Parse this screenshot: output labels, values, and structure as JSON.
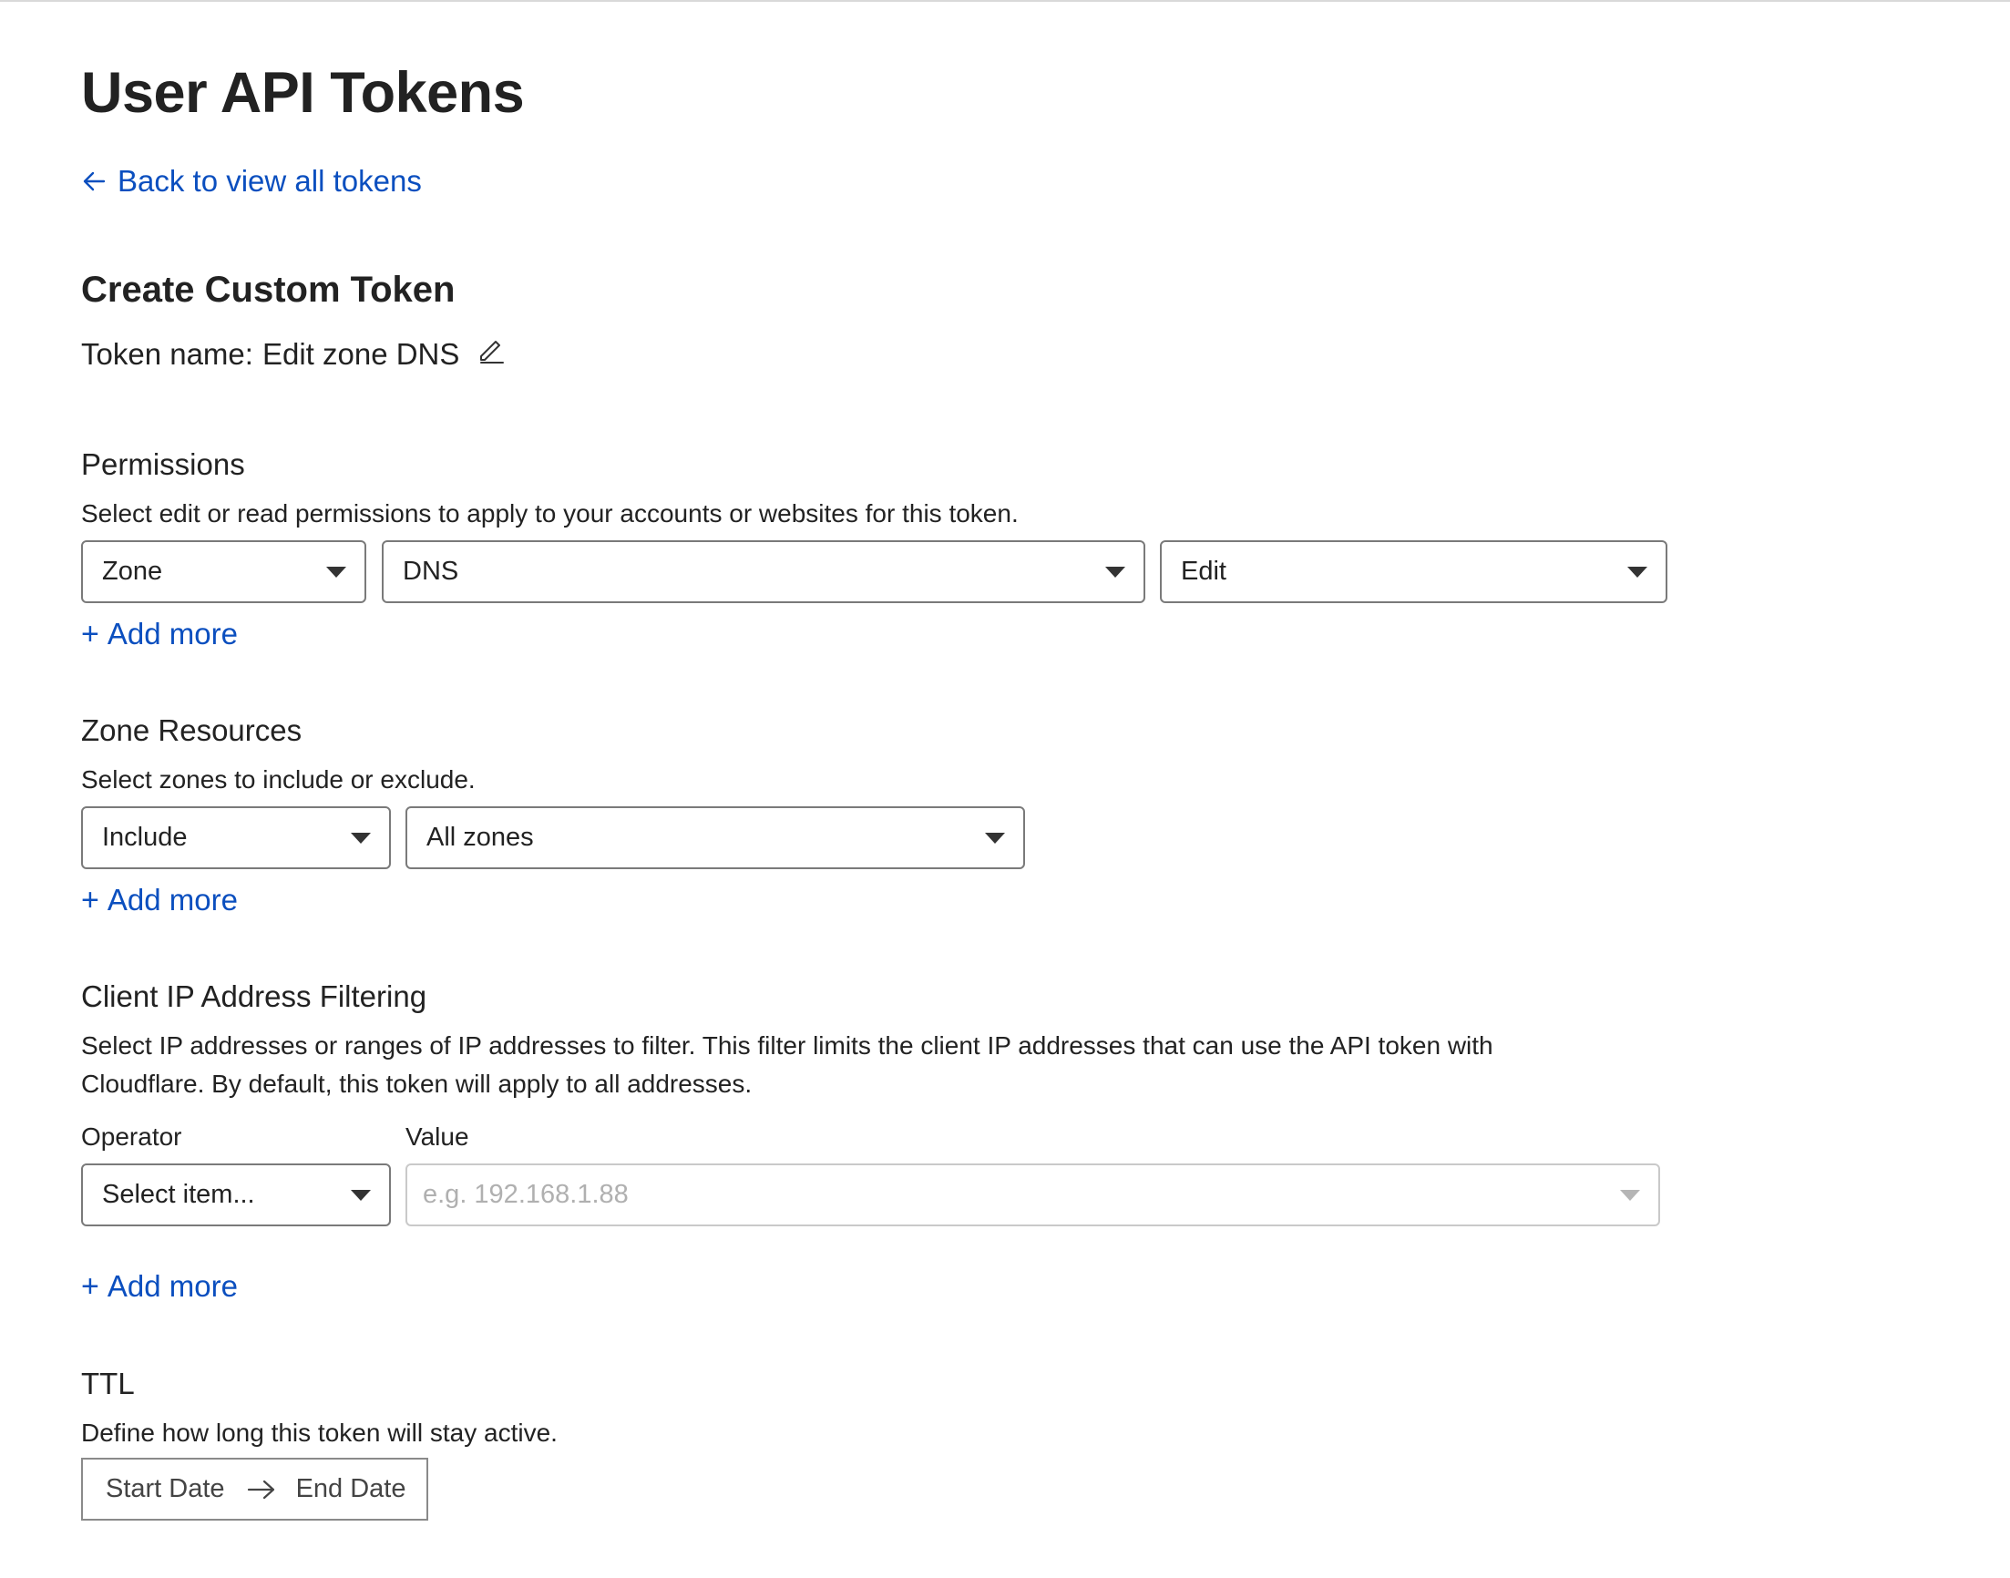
{
  "page": {
    "title": "User API Tokens",
    "back_link": "Back to view all tokens",
    "section_title": "Create Custom Token",
    "token_name_label": "Token name:",
    "token_name_value": "Edit zone DNS"
  },
  "permissions": {
    "heading": "Permissions",
    "description": "Select edit or read permissions to apply to your accounts or websites for this token.",
    "scope_select": "Zone",
    "resource_select": "DNS",
    "access_select": "Edit",
    "add_more": "Add more"
  },
  "zone_resources": {
    "heading": "Zone Resources",
    "description": "Select zones to include or exclude.",
    "mode_select": "Include",
    "zone_select": "All zones",
    "add_more": "Add more"
  },
  "ip_filtering": {
    "heading": "Client IP Address Filtering",
    "description_line1": "Select IP addresses or ranges of IP addresses to filter. This filter limits the client IP addresses that can use the API token with",
    "description_line2": "Cloudflare. By default, this token will apply to all addresses.",
    "operator_label": "Operator",
    "value_label": "Value",
    "operator_select": "Select item...",
    "value_placeholder": "e.g. 192.168.1.88",
    "add_more": "Add more"
  },
  "ttl": {
    "heading": "TTL",
    "description": "Define how long this token will stay active.",
    "start_date": "Start Date",
    "end_date": "End Date"
  },
  "colors": {
    "link": "#0b4fbf",
    "text": "#222222",
    "border": "#7a7a7a",
    "disabled_border": "#c9c9c9"
  }
}
